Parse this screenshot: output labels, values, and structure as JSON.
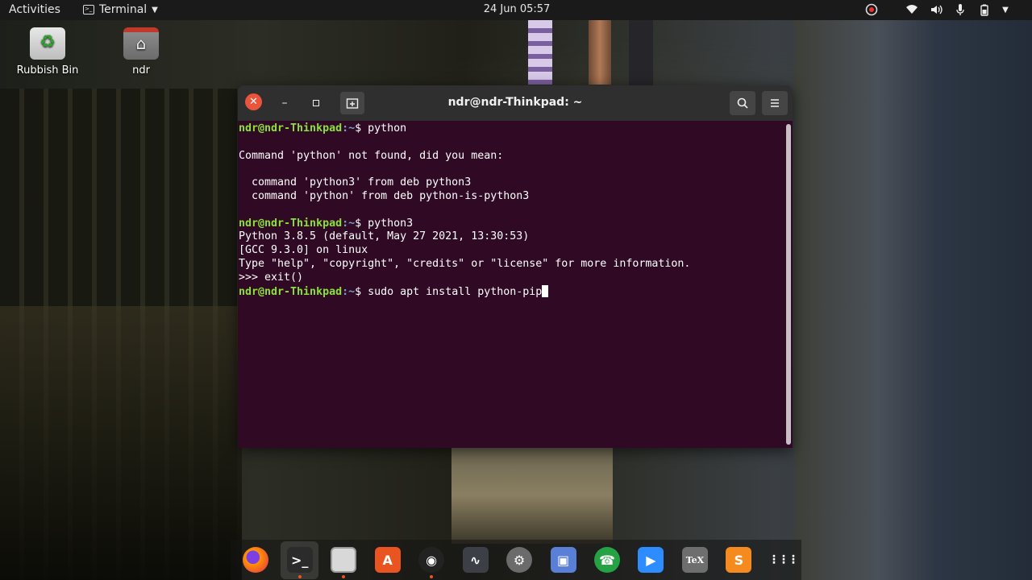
{
  "topbar": {
    "activities": "Activities",
    "app_name": "Terminal",
    "clock": "24 Jun  05:57"
  },
  "desktop": {
    "icons": [
      {
        "label": "Rubbish Bin",
        "icon": "recycle-bin-icon"
      },
      {
        "label": "ndr",
        "icon": "home-folder-icon"
      }
    ]
  },
  "terminal": {
    "title": "ndr@ndr-Thinkpad: ~",
    "prompt_user": "ndr@ndr-Thinkpad",
    "prompt_path": ":~",
    "prompt_symbol": "$ ",
    "lines": [
      {
        "type": "prompt",
        "cmd": "python"
      },
      {
        "type": "text",
        "text": ""
      },
      {
        "type": "text",
        "text": "Command 'python' not found, did you mean:"
      },
      {
        "type": "text",
        "text": ""
      },
      {
        "type": "text",
        "text": "  command 'python3' from deb python3"
      },
      {
        "type": "text",
        "text": "  command 'python' from deb python-is-python3"
      },
      {
        "type": "text",
        "text": ""
      },
      {
        "type": "prompt",
        "cmd": "python3"
      },
      {
        "type": "text",
        "text": "Python 3.8.5 (default, May 27 2021, 13:30:53)"
      },
      {
        "type": "text",
        "text": "[GCC 9.3.0] on linux"
      },
      {
        "type": "text",
        "text": "Type \"help\", \"copyright\", \"credits\" or \"license\" for more information."
      },
      {
        "type": "text",
        "text": ">>> exit()"
      },
      {
        "type": "prompt",
        "cmd": "sudo apt install python-pip",
        "cursor": true
      }
    ],
    "colors": {
      "background": "#300a24",
      "user": "#8ae234",
      "path": "#729fcf",
      "text": "#ffffff"
    }
  },
  "dock": {
    "items": [
      {
        "name": "firefox-icon",
        "glyph": "",
        "bg": "#e66000",
        "running": false
      },
      {
        "name": "terminal-icon",
        "glyph": ">_",
        "bg": "#2b2b2b",
        "running": true,
        "active": true
      },
      {
        "name": "files-icon",
        "glyph": "",
        "bg": "#d8d8d8",
        "running": true
      },
      {
        "name": "software-icon",
        "glyph": "A",
        "bg": "#e95420",
        "running": false
      },
      {
        "name": "obs-icon",
        "glyph": "◉",
        "bg": "#222222",
        "running": true
      },
      {
        "name": "system-monitor-icon",
        "glyph": "∿",
        "bg": "#3c3f45",
        "running": false
      },
      {
        "name": "settings-icon",
        "glyph": "⚙",
        "bg": "#6b6b6b",
        "running": false
      },
      {
        "name": "screenshot-icon",
        "glyph": "▣",
        "bg": "#5a7fd6",
        "running": false
      },
      {
        "name": "whatsapp-icon",
        "glyph": "☎",
        "bg": "#25a244",
        "running": false
      },
      {
        "name": "zoom-icon",
        "glyph": "▶",
        "bg": "#2d8cff",
        "running": false
      },
      {
        "name": "texmaker-icon",
        "glyph": "TeX",
        "bg": "#6e6e6e",
        "running": false
      },
      {
        "name": "sublime-icon",
        "glyph": "S",
        "bg": "#f58b1f",
        "running": false
      },
      {
        "name": "app-grid-icon",
        "glyph": "⋮⋮⋮",
        "bg": "transparent",
        "running": false
      }
    ]
  }
}
